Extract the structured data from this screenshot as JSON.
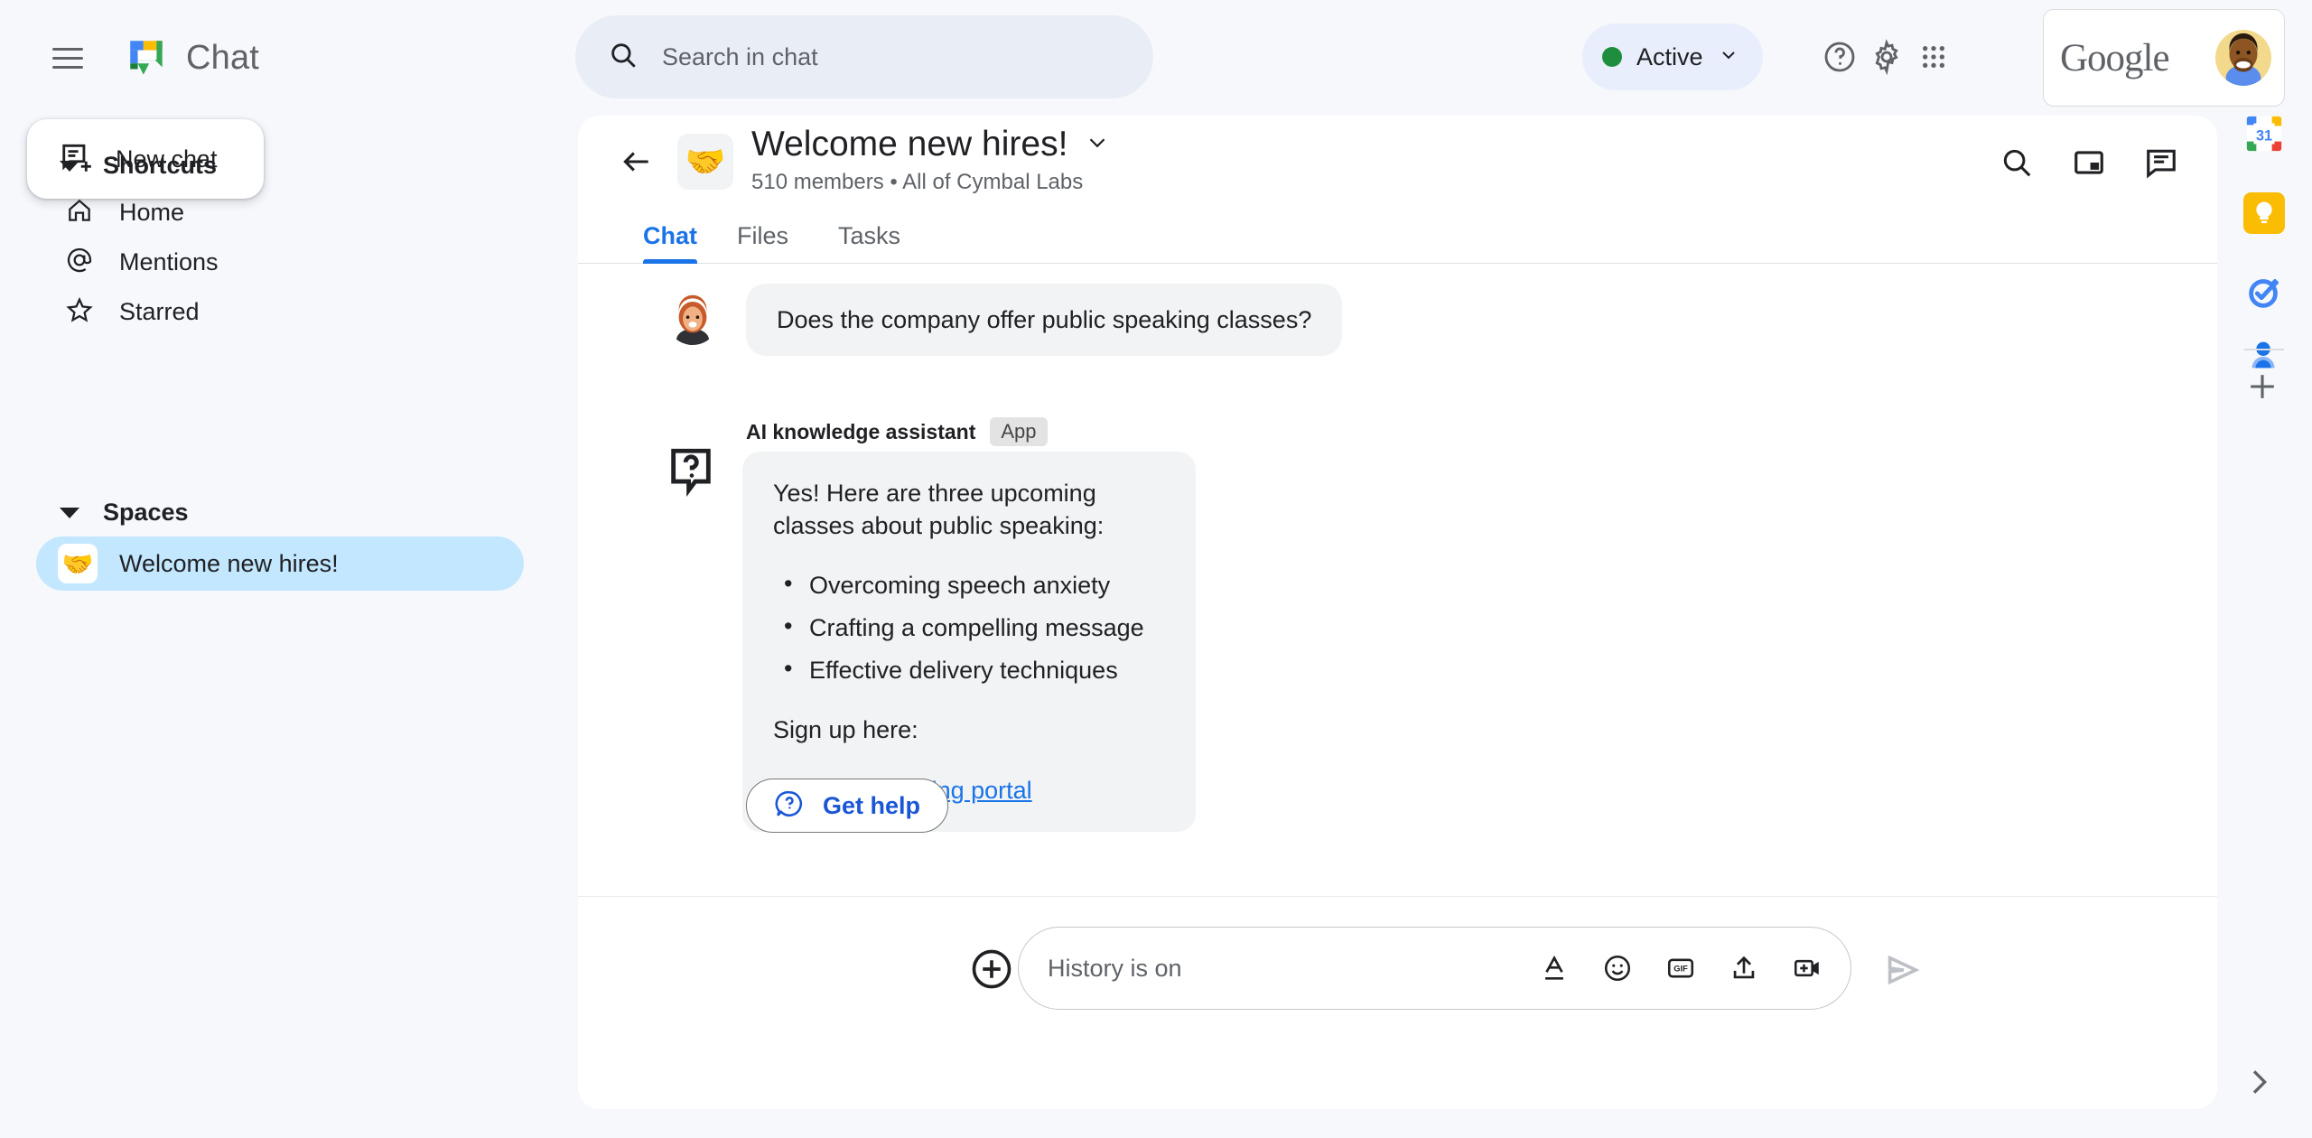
{
  "app": {
    "brand_title": "Chat",
    "logo_icon": "google-chat-logo",
    "menu_icon": "hamburger-menu-icon"
  },
  "search": {
    "placeholder": "Search in chat",
    "icon": "search-icon"
  },
  "topbar": {
    "status_label": "Active",
    "status_color": "#1e8e3e",
    "status_caret_icon": "chevron-down-icon",
    "help_icon": "help-circle-icon",
    "settings_icon": "gear-icon",
    "apps_icon": "apps-grid-icon",
    "account_word": "Google",
    "avatar_icon": "user-avatar"
  },
  "sidebar": {
    "new_chat_label": "New chat",
    "new_chat_icon": "new-chat-icon",
    "shortcuts_title": "Shortcuts",
    "shortcuts": [
      {
        "label": "Home",
        "icon": "home-icon"
      },
      {
        "label": "Mentions",
        "icon": "at-mention-icon"
      },
      {
        "label": "Starred",
        "icon": "star-icon"
      }
    ],
    "spaces_title": "Spaces",
    "spaces": [
      {
        "label": "Welcome new hires!",
        "emoji": "🤝",
        "selected": true
      }
    ]
  },
  "conversation": {
    "back_icon": "back-arrow-icon",
    "emoji": "🤝",
    "title": "Welcome new hires!",
    "title_caret_icon": "chevron-down-icon",
    "subtitle": "510 members  •  All of Cymbal Labs",
    "actions": [
      {
        "icon": "search-icon"
      },
      {
        "icon": "picture-in-picture-icon"
      },
      {
        "icon": "threads-icon"
      }
    ],
    "tabs": [
      {
        "label": "Chat",
        "active": true
      },
      {
        "label": "Files",
        "active": false
      },
      {
        "label": "Tasks",
        "active": false
      }
    ]
  },
  "messages": {
    "user_message": {
      "text": "Does the company offer public speaking classes?",
      "avatar_icon": "user-avatar"
    },
    "ai_message": {
      "sender": "AI knowledge assistant",
      "badge": "App",
      "icon": "question-bubble-icon",
      "intro": "Yes! Here are three upcoming classes about public speaking:",
      "items": [
        "Overcoming speech anxiety",
        "Crafting a compelling message",
        "Effective delivery techniques"
      ],
      "signup_text": "Sign up here:",
      "link_text": "Company training portal"
    },
    "get_help_label": "Get help",
    "get_help_icon": "question-bubble-icon"
  },
  "composer": {
    "placeholder": "History is on",
    "add_icon": "plus-circle-icon",
    "tools": [
      {
        "icon": "format-text-icon"
      },
      {
        "icon": "emoji-icon"
      },
      {
        "icon": "gif-icon"
      },
      {
        "icon": "upload-icon"
      },
      {
        "icon": "add-video-icon"
      }
    ],
    "send_icon": "send-icon"
  },
  "right_rail": {
    "items": [
      {
        "icon": "google-calendar-icon",
        "day": "31"
      },
      {
        "icon": "google-keep-icon"
      },
      {
        "icon": "google-tasks-icon"
      },
      {
        "icon": "google-contacts-icon"
      }
    ],
    "add_icon": "plus-icon",
    "expand_icon": "chevron-right-icon"
  }
}
